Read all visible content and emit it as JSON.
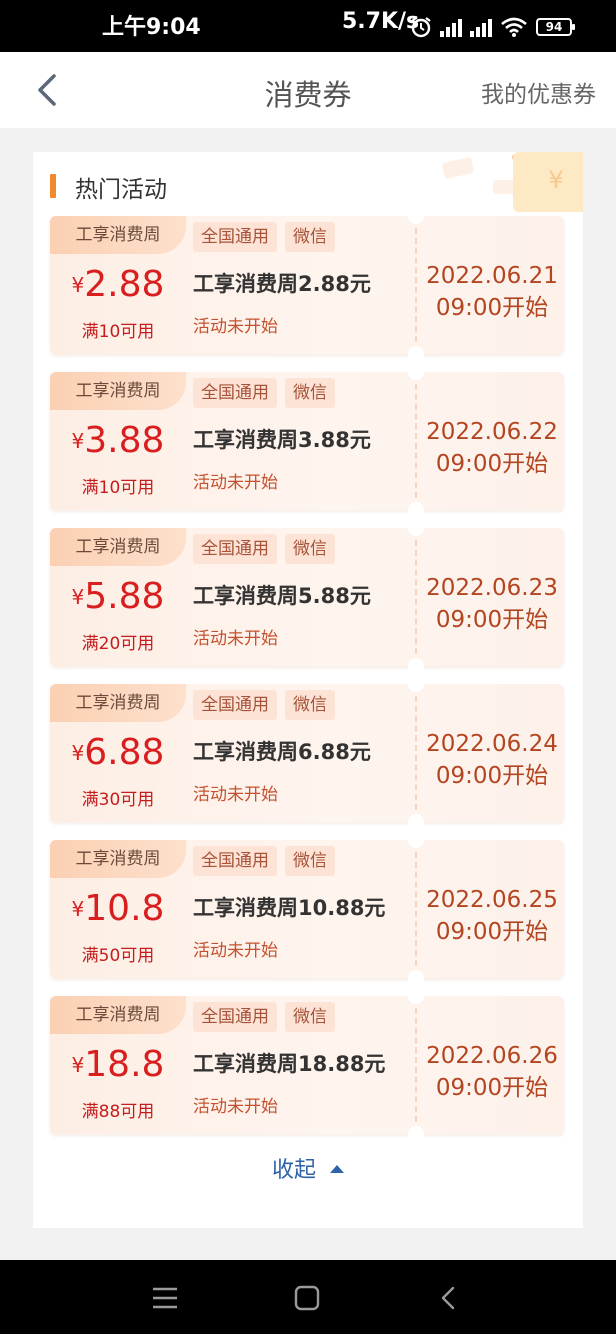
{
  "status_bar": {
    "time": "上午9:04",
    "network_speed": "5.7K/s",
    "battery": "94",
    "icons": [
      "alarm-icon",
      "hd-signal-icon",
      "signal-icon",
      "wifi-icon",
      "battery-icon"
    ]
  },
  "header": {
    "title": "消费券",
    "right_link": "我的优惠券",
    "back_icon": "chevron-left-icon"
  },
  "section": {
    "title": "热门活动",
    "accent_color": "#f08a2c"
  },
  "coupons": [
    {
      "tag": "工享消费周",
      "chip_scope": "全国通用",
      "chip_channel": "微信",
      "currency": "¥",
      "amount": "2.88",
      "condition": "满10可用",
      "name": "工享消费周2.88元",
      "status": "活动未开始",
      "date": "2022.06.21",
      "time": "09:00开始"
    },
    {
      "tag": "工享消费周",
      "chip_scope": "全国通用",
      "chip_channel": "微信",
      "currency": "¥",
      "amount": "3.88",
      "condition": "满10可用",
      "name": "工享消费周3.88元",
      "status": "活动未开始",
      "date": "2022.06.22",
      "time": "09:00开始"
    },
    {
      "tag": "工享消费周",
      "chip_scope": "全国通用",
      "chip_channel": "微信",
      "currency": "¥",
      "amount": "5.88",
      "condition": "满20可用",
      "name": "工享消费周5.88元",
      "status": "活动未开始",
      "date": "2022.06.23",
      "time": "09:00开始"
    },
    {
      "tag": "工享消费周",
      "chip_scope": "全国通用",
      "chip_channel": "微信",
      "currency": "¥",
      "amount": "6.88",
      "condition": "满30可用",
      "name": "工享消费周6.88元",
      "status": "活动未开始",
      "date": "2022.06.24",
      "time": "09:00开始"
    },
    {
      "tag": "工享消费周",
      "chip_scope": "全国通用",
      "chip_channel": "微信",
      "currency": "¥",
      "amount": "10.8",
      "condition": "满50可用",
      "name": "工享消费周10.88元",
      "status": "活动未开始",
      "date": "2022.06.25",
      "time": "09:00开始"
    },
    {
      "tag": "工享消费周",
      "chip_scope": "全国通用",
      "chip_channel": "微信",
      "currency": "¥",
      "amount": "18.8",
      "condition": "满88可用",
      "name": "工享消费周18.88元",
      "status": "活动未开始",
      "date": "2022.06.26",
      "time": "09:00开始"
    }
  ],
  "collapse_label": "收起",
  "colors": {
    "amount_red": "#d81e1e",
    "date_brown": "#b34520",
    "link_blue": "#2f63a8"
  },
  "system_nav": [
    "menu-icon",
    "home-icon",
    "back-icon"
  ]
}
